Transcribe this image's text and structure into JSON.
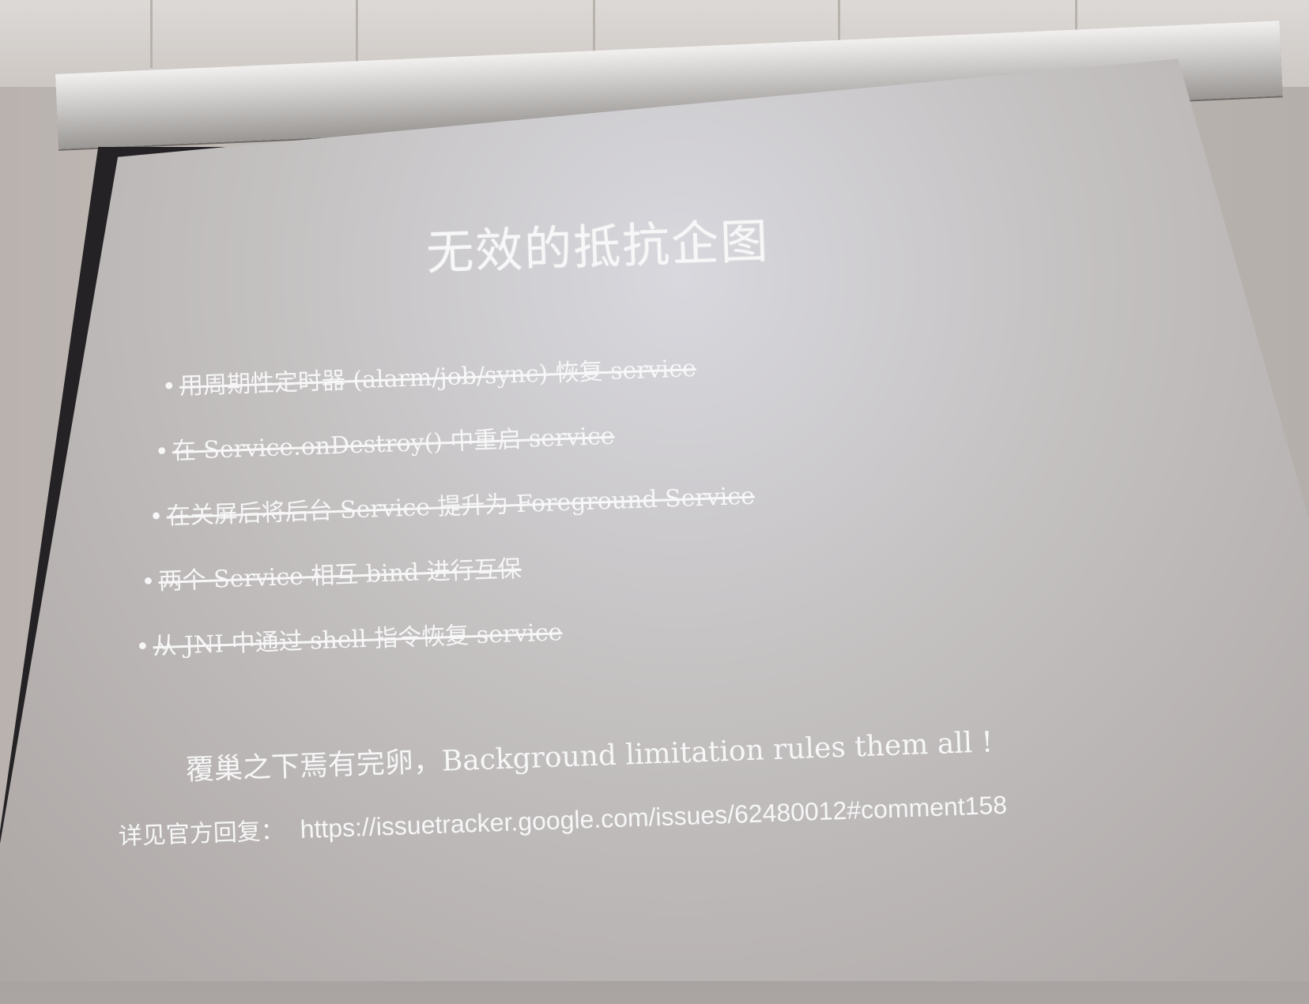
{
  "slide": {
    "title": "无效的抵抗企图",
    "bullets": [
      "用周期性定时器 (alarm/job/sync) 恢复 service",
      "在 Service.onDestroy() 中重启 service",
      "在关屏后将后台 Service 提升为 Foreground Service",
      "两个 Service 相互 bind 进行互保",
      "从 JNI 中通过 shell 指令恢复 service"
    ],
    "bullet_marker": "•",
    "motto": "覆巢之下焉有完卵，Background limitation rules them all !",
    "reference_label": "详见官方回复：",
    "reference_url": "https://issuetracker.google.com/issues/62480012#comment158"
  },
  "colors": {
    "slide_text": "#f7f7f8",
    "screen": "#c4c1c1",
    "frame": "#242224"
  }
}
